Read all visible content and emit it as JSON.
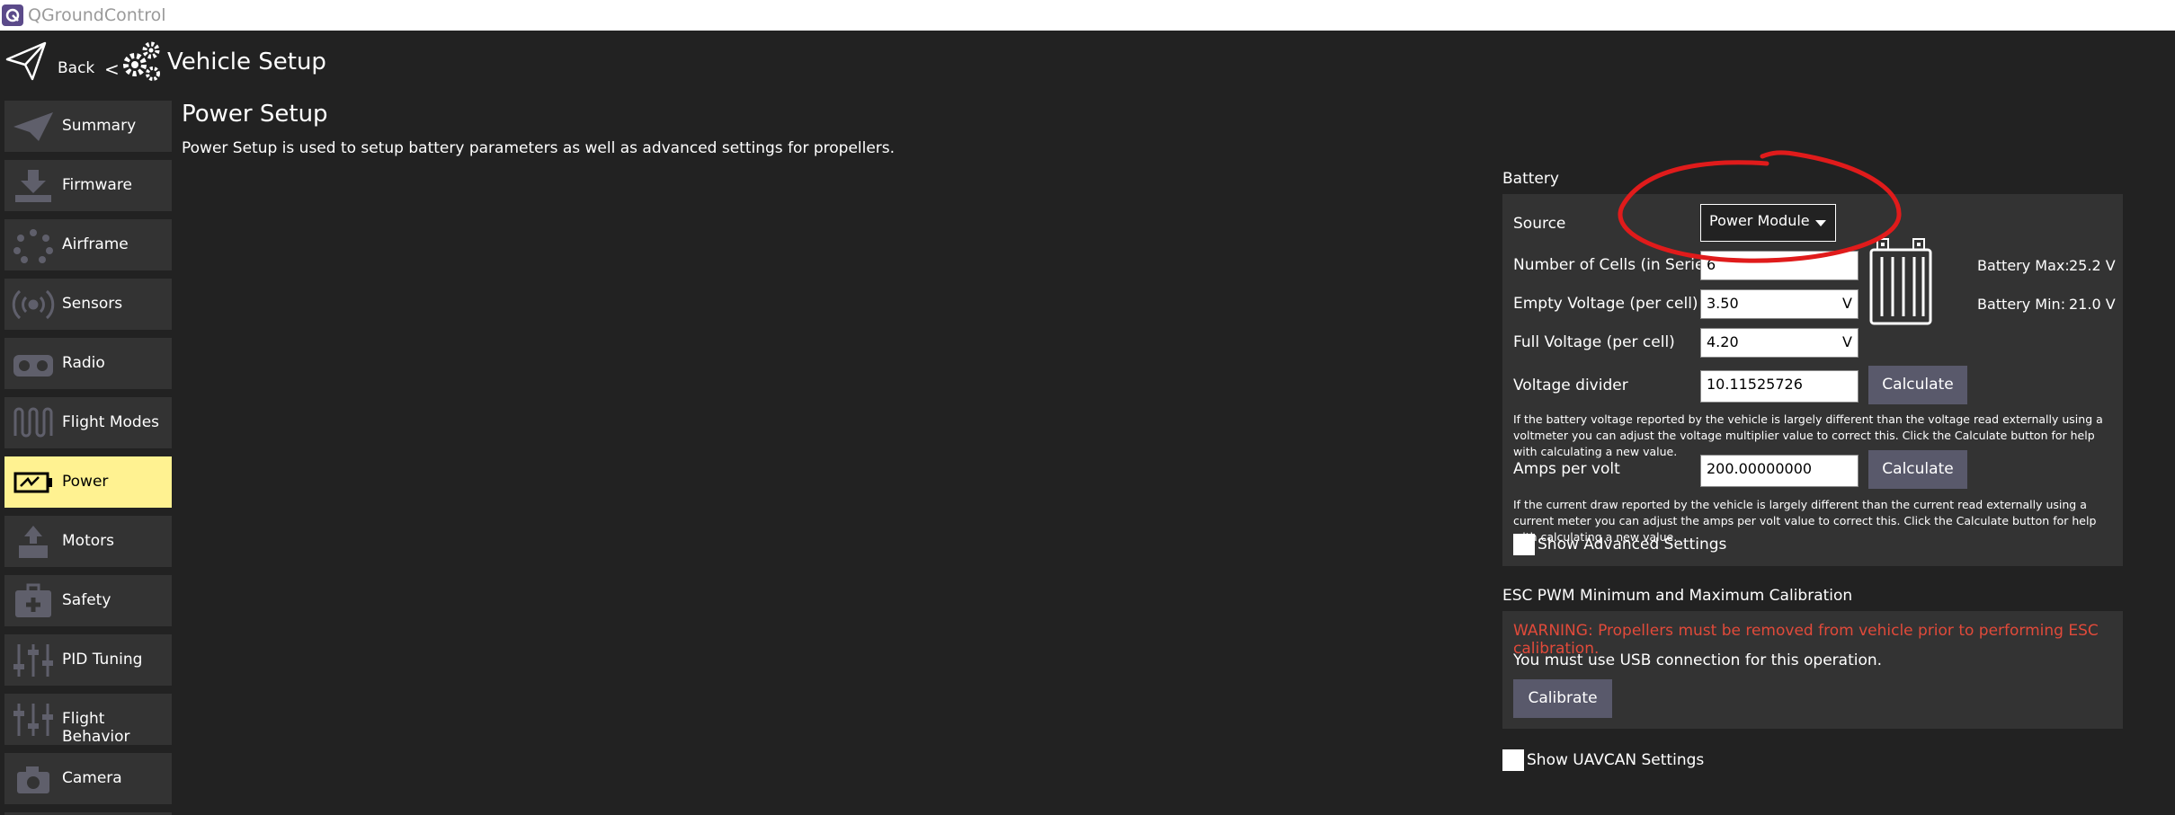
{
  "window": {
    "title": "QGroundControl"
  },
  "toolbar": {
    "back_label": "Back",
    "chevron": "<",
    "title": "Vehicle Setup"
  },
  "sidebar": {
    "items": [
      {
        "label": "Summary",
        "icon": "paper-plane-icon"
      },
      {
        "label": "Firmware",
        "icon": "download-icon"
      },
      {
        "label": "Airframe",
        "icon": "airframe-icon"
      },
      {
        "label": "Sensors",
        "icon": "sensors-icon"
      },
      {
        "label": "Radio",
        "icon": "radio-icon"
      },
      {
        "label": "Flight Modes",
        "icon": "flight-modes-icon"
      },
      {
        "label": "Power",
        "icon": "battery-icon"
      },
      {
        "label": "Motors",
        "icon": "motors-icon"
      },
      {
        "label": "Safety",
        "icon": "medkit-icon"
      },
      {
        "label": "PID Tuning",
        "icon": "sliders-icon"
      },
      {
        "label": "Flight Behavior",
        "icon": "sliders-icon"
      },
      {
        "label": "Camera",
        "icon": "camera-icon"
      }
    ],
    "active": "Power"
  },
  "page": {
    "title": "Power Setup",
    "description": "Power Setup is used to setup battery parameters as well as advanced settings for propellers."
  },
  "battery": {
    "section_title": "Battery",
    "source_label": "Source",
    "source_value": "Power Module",
    "cells_label": "Number of Cells (in Series)",
    "cells_value": "6",
    "empty_label": "Empty Voltage (per cell)",
    "empty_value": "3.50",
    "full_label": "Full Voltage (per cell)",
    "full_value": "4.20",
    "unit_v": "V",
    "divider_label": "Voltage divider",
    "divider_value": "10.11525726",
    "calculate_label": "Calculate",
    "divider_help": "If the battery voltage reported by the vehicle is largely different than the voltage read externally using a voltmeter you can adjust the voltage multiplier value to correct this. Click the Calculate button for help with calculating a new value.",
    "amps_label": "Amps per volt",
    "amps_value": "200.00000000",
    "amps_help": "If the current draw reported by the vehicle is largely different than the current read externally using a current meter you can adjust the amps per volt value to correct this. Click the Calculate button for help with calculating a new value.",
    "advanced_label": "Show Advanced Settings",
    "max_label": "Battery Max:",
    "max_value": "25.2 V",
    "min_label": "Battery Min:",
    "min_value": "21.0 V"
  },
  "esc": {
    "section_title": "ESC PWM Minimum and Maximum Calibration",
    "warning": "WARNING: Propellers must be removed from vehicle prior to performing ESC calibration.",
    "usb_note": "You must use USB connection for this operation.",
    "calibrate_label": "Calibrate"
  },
  "uavcan": {
    "label": "Show UAVCAN Settings"
  },
  "colors": {
    "active_item": "#fff291",
    "panel": "#333333",
    "warning": "#e14a3a",
    "annotation": "#e01b1b"
  }
}
